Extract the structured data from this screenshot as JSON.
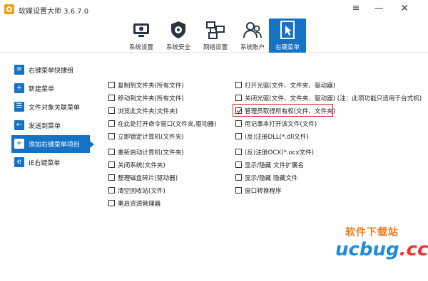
{
  "window": {
    "title": "软媒设置大师 3.6.7.0",
    "controls": {
      "menu": "≡",
      "minimize": "—",
      "close": "✕"
    }
  },
  "toolbar": {
    "items": [
      {
        "label": "系统设置",
        "icon": "system-settings-icon",
        "active": false
      },
      {
        "label": "系统安全",
        "icon": "shield-gear-icon",
        "active": false
      },
      {
        "label": "网络设置",
        "icon": "network-icon",
        "active": false
      },
      {
        "label": "系统账户",
        "icon": "users-icon",
        "active": false
      },
      {
        "label": "右键菜单",
        "icon": "cursor-click-icon",
        "active": true
      }
    ]
  },
  "sidebar": {
    "items": [
      {
        "label": "右键菜单快捷组",
        "active": false
      },
      {
        "label": "新建菜单",
        "active": false
      },
      {
        "label": "文件对象关联菜单",
        "active": false
      },
      {
        "label": "发送到菜单",
        "active": false
      },
      {
        "label": "添加右键菜单项目",
        "active": true
      },
      {
        "label": "IE右键菜单",
        "active": false
      }
    ]
  },
  "options": {
    "left": [
      {
        "label": "复制到文件夹(所有文件)",
        "checked": false
      },
      {
        "label": "移动到文件夹(所有文件)",
        "checked": false
      },
      {
        "label": "浏览此文件夹(文件夹)",
        "checked": false
      },
      {
        "label": "在此处打开命令窗口(文件夹,驱动器)",
        "checked": false
      },
      {
        "label": "立即锁定计算机(文件夹)",
        "checked": false
      },
      {
        "label": "重新启动计算机(文件夹)",
        "checked": false
      },
      {
        "label": "关闭系统(文件夹)",
        "checked": false
      },
      {
        "label": "整理磁盘碎片(驱动器)",
        "checked": false
      },
      {
        "label": "清空回收站(文件)",
        "checked": false
      },
      {
        "label": "重启资源管理器",
        "checked": false
      }
    ],
    "right": [
      {
        "label": "打开光驱(文件、文件夹、驱动器)",
        "checked": false
      },
      {
        "label": "关闭光驱(文件、文件夹、驱动器) (注：此项功能只适用于台式机)",
        "checked": false
      },
      {
        "label": "管理员取得所有权(文件、文件夹)",
        "checked": true
      },
      {
        "label": "用记事本打开该文件(文件)",
        "checked": false
      },
      {
        "label": "(反)注册DLL(*.dll文件)",
        "checked": false
      },
      {
        "label": "(反)注册OCX(*.ocx文件)",
        "checked": false
      },
      {
        "label": "显示/隐藏 文件扩展名",
        "checked": false
      },
      {
        "label": "显示/隐藏 隐藏文件",
        "checked": false
      },
      {
        "label": "窗口转换程序",
        "checked": false
      }
    ]
  },
  "watermark": {
    "cn": "软件下载站",
    "en_main": "ucbug",
    "en_tld": ".cc"
  },
  "colors": {
    "accent": "#1572c4",
    "highlight": "#e02020",
    "wm_orange": "#f27a1a",
    "wm_blue": "#1a8be0"
  }
}
